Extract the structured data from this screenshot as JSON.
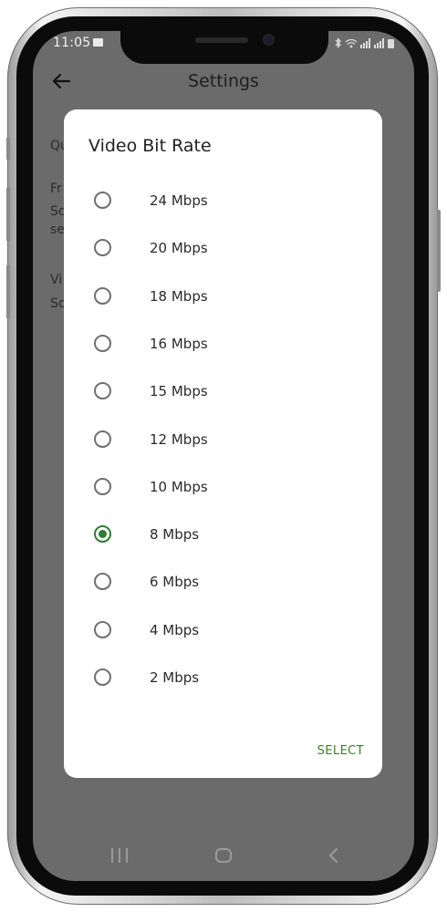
{
  "status_bar": {
    "time": "11:05"
  },
  "app_bar": {
    "title": "Settings"
  },
  "background": {
    "items": [
      "Qu",
      "Fr",
      "Sc",
      "se",
      "Vi",
      "Sc"
    ]
  },
  "dialog": {
    "title": "Video Bit Rate",
    "options": [
      {
        "label": "24 Mbps",
        "selected": false
      },
      {
        "label": "20 Mbps",
        "selected": false
      },
      {
        "label": "18 Mbps",
        "selected": false
      },
      {
        "label": "16 Mbps",
        "selected": false
      },
      {
        "label": "15 Mbps",
        "selected": false
      },
      {
        "label": "12 Mbps",
        "selected": false
      },
      {
        "label": "10 Mbps",
        "selected": false
      },
      {
        "label": "8 Mbps",
        "selected": true
      },
      {
        "label": "6 Mbps",
        "selected": false
      },
      {
        "label": "4 Mbps",
        "selected": false
      },
      {
        "label": "2 Mbps",
        "selected": false
      }
    ],
    "select_label": "SELECT"
  },
  "colors": {
    "accent": "#2e7d32",
    "scrim": "#6b6b6b"
  },
  "icons": [
    "back-arrow-icon",
    "gallery-icon",
    "bluetooth-icon",
    "wifi-icon",
    "signal-icon",
    "battery-icon",
    "recent-apps-icon",
    "home-icon",
    "nav-back-icon"
  ]
}
